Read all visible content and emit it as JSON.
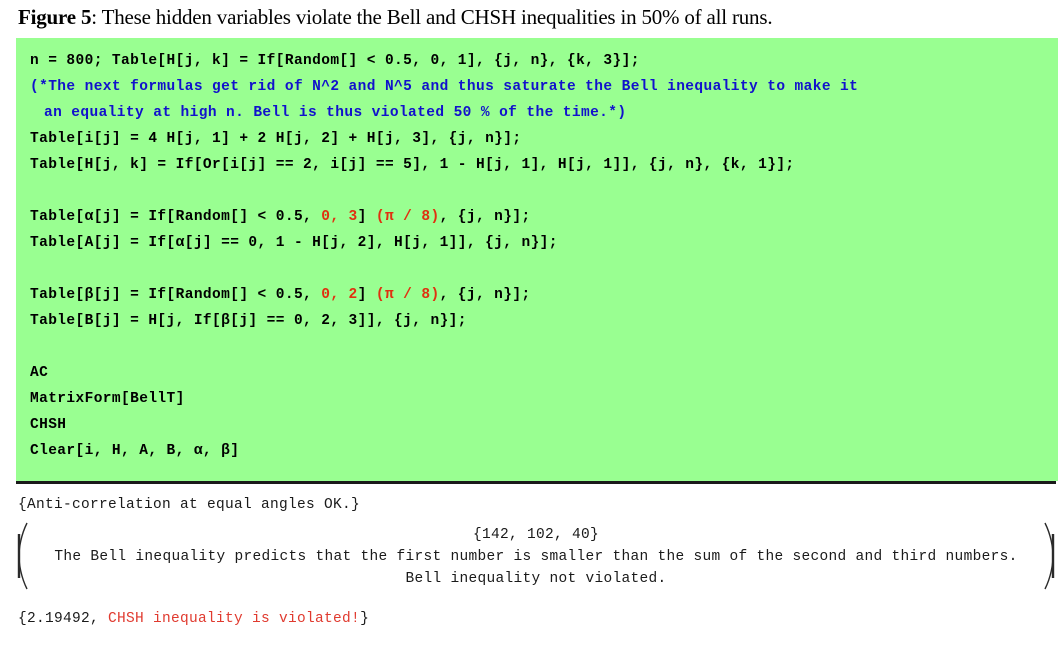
{
  "caption": {
    "label": "Figure 5",
    "text": ": These hidden variables violate the Bell and CHSH inequalities in 50% of all runs."
  },
  "code_cell": {
    "background_color": "#99ff91",
    "comment_color": "#1111cc",
    "highlight_color": "#e03010",
    "lines": [
      {
        "id": "l1",
        "text": "n = 800; Table[H[j, k] = If[Random[] < 0.5, 0, 1], {j, n}, {k, 3}];"
      },
      {
        "id": "l2",
        "text": "(*The next formulas get rid of N^2 and N^5 and thus saturate the Bell inequality to make it"
      },
      {
        "id": "l3",
        "text": "an equality at high n. Bell is thus violated 50 % of the time.*)"
      },
      {
        "id": "l4",
        "text": "Table[i[j] = 4 H[j, 1] + 2 H[j, 2] + H[j, 3], {j, n}];"
      },
      {
        "id": "l5",
        "text": "Table[H[j, k] = If[Or[i[j] == 2, i[j] == 5], 1 - H[j, 1], H[j, 1]], {j, n}, {k, 1}];"
      },
      {
        "id": "l6",
        "text": ""
      },
      {
        "id": "l7a",
        "text": "Table[α[j] = If[Random[] < 0.5, "
      },
      {
        "id": "l7b",
        "text": "0, 3"
      },
      {
        "id": "l7c",
        "text": "] "
      },
      {
        "id": "l7d",
        "text": "(π / 8)"
      },
      {
        "id": "l7e",
        "text": ", {j, n}];"
      },
      {
        "id": "l8",
        "text": "Table[A[j] = If[α[j] == 0, 1 - H[j, 2], H[j, 1]], {j, n}];"
      },
      {
        "id": "l9",
        "text": ""
      },
      {
        "id": "l10a",
        "text": "Table[β[j] = If[Random[] < 0.5, "
      },
      {
        "id": "l10b",
        "text": "0, 2"
      },
      {
        "id": "l10c",
        "text": "] "
      },
      {
        "id": "l10d",
        "text": "(π / 8)"
      },
      {
        "id": "l10e",
        "text": ", {j, n}];"
      },
      {
        "id": "l11",
        "text": "Table[B[j] = H[j, If[β[j] == 0, 2, 3]], {j, n}];"
      },
      {
        "id": "l12",
        "text": ""
      },
      {
        "id": "l13",
        "text": "AC"
      },
      {
        "id": "l14",
        "text": "MatrixForm[BellT]"
      },
      {
        "id": "l15",
        "text": "CHSH"
      },
      {
        "id": "l16",
        "text": "Clear[i, H, A, B, α, β]"
      }
    ]
  },
  "output": {
    "anti_correlation": "{Anti-correlation at equal angles OK.}",
    "matrix_rows": [
      "{142, 102, 40}",
      "The Bell inequality predicts that the first number is smaller than the sum of the second and third numbers.",
      "Bell inequality not violated."
    ],
    "chsh_prefix": "{2.19492, ",
    "chsh_message": "CHSH inequality is violated!",
    "chsh_suffix": "}"
  }
}
